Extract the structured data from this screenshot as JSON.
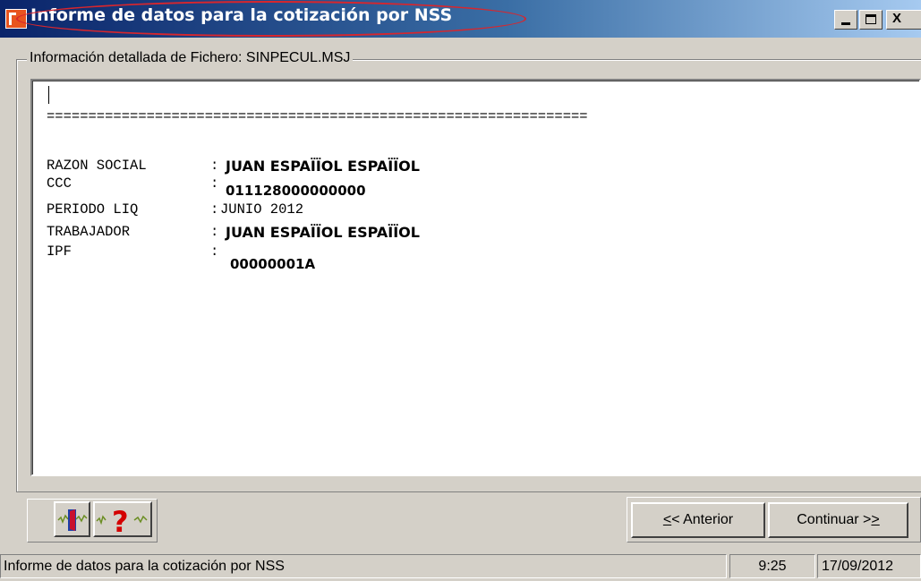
{
  "window": {
    "title": "Informe de datos para la cotización por NSS",
    "minimize_label": "_",
    "close_label": "X"
  },
  "group": {
    "label": "Información detallada de Fichero: SINPECUL.MSJ"
  },
  "report": {
    "separator": "=================================================================",
    "fields": [
      {
        "label": "RAZON SOCIAL",
        "sep": ":",
        "value": "JUAN ESPAÏÏOL ESPAÏÏOL"
      },
      {
        "label": "CCC",
        "sep": ":",
        "value": "011128000000000"
      },
      {
        "label": "PERIODO LIQ",
        "sep": ":",
        "value": "JUNIO 2012"
      },
      {
        "label": "TRABAJADOR",
        "sep": ":",
        "value": "JUAN ESPAÏÏOL ESPAÏÏOL"
      },
      {
        "label": "IPF",
        "sep": ":",
        "value": "00000001A"
      }
    ]
  },
  "toolbar": {
    "help_icon": "question-mark",
    "exit_icon": "door-exit"
  },
  "nav": {
    "prev_prefix": "<",
    "prev_underlined": "<",
    "prev_text": " Anterior",
    "next_text": "Continuar >",
    "next_underlined": ">"
  },
  "status": {
    "message": "Informe de datos para la cotización por NSS",
    "time": "9:25",
    "date": "17/09/2012"
  },
  "colors": {
    "title_accent": "#0a246a",
    "highlight_ellipse": "#d8262d",
    "app_icon": "#e8541f"
  }
}
